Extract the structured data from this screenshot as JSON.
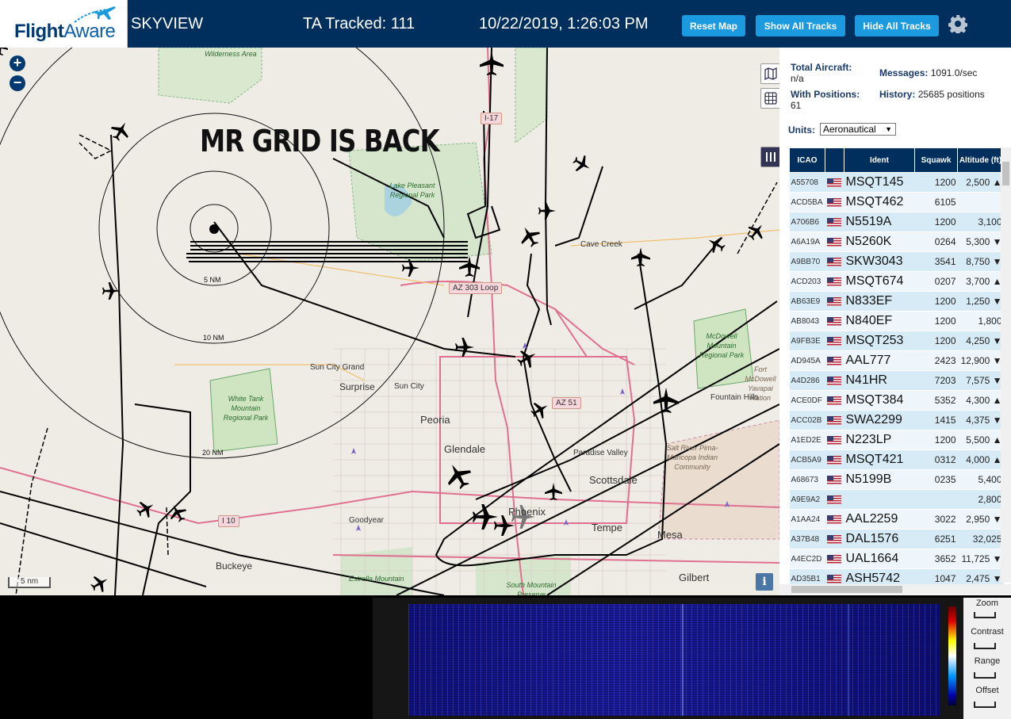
{
  "header": {
    "logo_main": "Flight",
    "logo_sub": "Aware",
    "skyview": "SKYVIEW",
    "tracked": "TA Tracked: 111",
    "datetime": "10/22/2019, 1:26:03 PM",
    "reset_map": "Reset Map",
    "show_all": "Show All Tracks",
    "hide_all": "Hide All Tracks",
    "settings_icon": "gear-icon"
  },
  "map": {
    "banner": "MR GRID IS BACK",
    "zoom_in": "+",
    "zoom_out": "−",
    "scale": "5 nm",
    "info": "i",
    "range_labels": [
      "5 NM",
      "10 NM",
      "20 NM"
    ],
    "places": [
      "Wilderness Area",
      "Lake Pleasant Regional Park",
      "Cave Creek",
      "Sun City Grand",
      "Surprise",
      "Sun City",
      "Peoria",
      "Glendale",
      "Paradise Valley",
      "Scottsdale",
      "Phoenix",
      "Tempe",
      "Mesa",
      "Gilbert",
      "Goodyear",
      "Buckeye",
      "Fountain Hills",
      "White Tank Mountain Regional Park",
      "McDowell Mountain Regional Park",
      "Salt River Pima-Maricopa Indian Community",
      "Estrella Mountain",
      "South Mountain Preserve",
      "Fort McDowell Yavapai Nation"
    ],
    "shields": [
      "I-17",
      "AZ 303 Loop",
      "AZ 51",
      "I 10"
    ],
    "colors": {
      "land": "#efece5",
      "park": "#cfe5c2",
      "road": "#e07090",
      "track": "#000000"
    }
  },
  "stats": {
    "total_label": "Total Aircraft:",
    "total_value": "n/a",
    "positions_label": "With Positions:",
    "positions_value": "61",
    "messages_label": "Messages:",
    "messages_value": "1091.0/sec",
    "history_label": "History:",
    "history_value": "25685 positions",
    "units_label": "Units:",
    "units_value": "Aeronautical"
  },
  "table": {
    "headers": [
      "ICAO",
      "",
      "Ident",
      "Squawk",
      "Altitude (ft)"
    ],
    "rows": [
      [
        "A55708",
        "MSQT145",
        "1200",
        "2,500 ▲"
      ],
      [
        "ACD5BA",
        "MSQT462",
        "6105",
        ""
      ],
      [
        "A706B6",
        "N5519A",
        "1200",
        "3,100"
      ],
      [
        "A6A19A",
        "N5260K",
        "0264",
        "5,300 ▼"
      ],
      [
        "A9BB70",
        "SKW3043",
        "3541",
        "8,750 ▼"
      ],
      [
        "ACD203",
        "MSQT674",
        "0207",
        "3,700 ▲"
      ],
      [
        "AB63E9",
        "N833EF",
        "1200",
        "1,250 ▼"
      ],
      [
        "AB8043",
        "N840EF",
        "1200",
        "1,800"
      ],
      [
        "A9FB3E",
        "MSQT253",
        "1200",
        "4,250 ▼"
      ],
      [
        "AD945A",
        "AAL777",
        "2423",
        "12,900 ▼"
      ],
      [
        "A4D286",
        "N41HR",
        "7203",
        "7,575 ▼"
      ],
      [
        "ACE0DF",
        "MSQT384",
        "5352",
        "4,300 ▲"
      ],
      [
        "ACC02B",
        "SWA2299",
        "1415",
        "4,375 ▼"
      ],
      [
        "A1ED2E",
        "N223LP",
        "1200",
        "5,500 ▲"
      ],
      [
        "ACB5A9",
        "MSQT421",
        "0312",
        "4,000 ▲"
      ],
      [
        "A68673",
        "N5199B",
        "0235",
        "5,400"
      ],
      [
        "A9E9A2",
        "",
        "",
        "2,800"
      ],
      [
        "A1AA24",
        "AAL2259",
        "3022",
        "2,950 ▼"
      ],
      [
        "A37B48",
        "DAL1576",
        "6251",
        "32,025"
      ],
      [
        "A4EC2D",
        "UAL1664",
        "3652",
        "11,725 ▼"
      ],
      [
        "AD35B1",
        "ASH5742",
        "1047",
        "2,475 ▼"
      ]
    ]
  },
  "waterfall": {
    "zoom": "Zoom",
    "contrast": "Contrast",
    "range": "Range",
    "offset": "Offset"
  }
}
